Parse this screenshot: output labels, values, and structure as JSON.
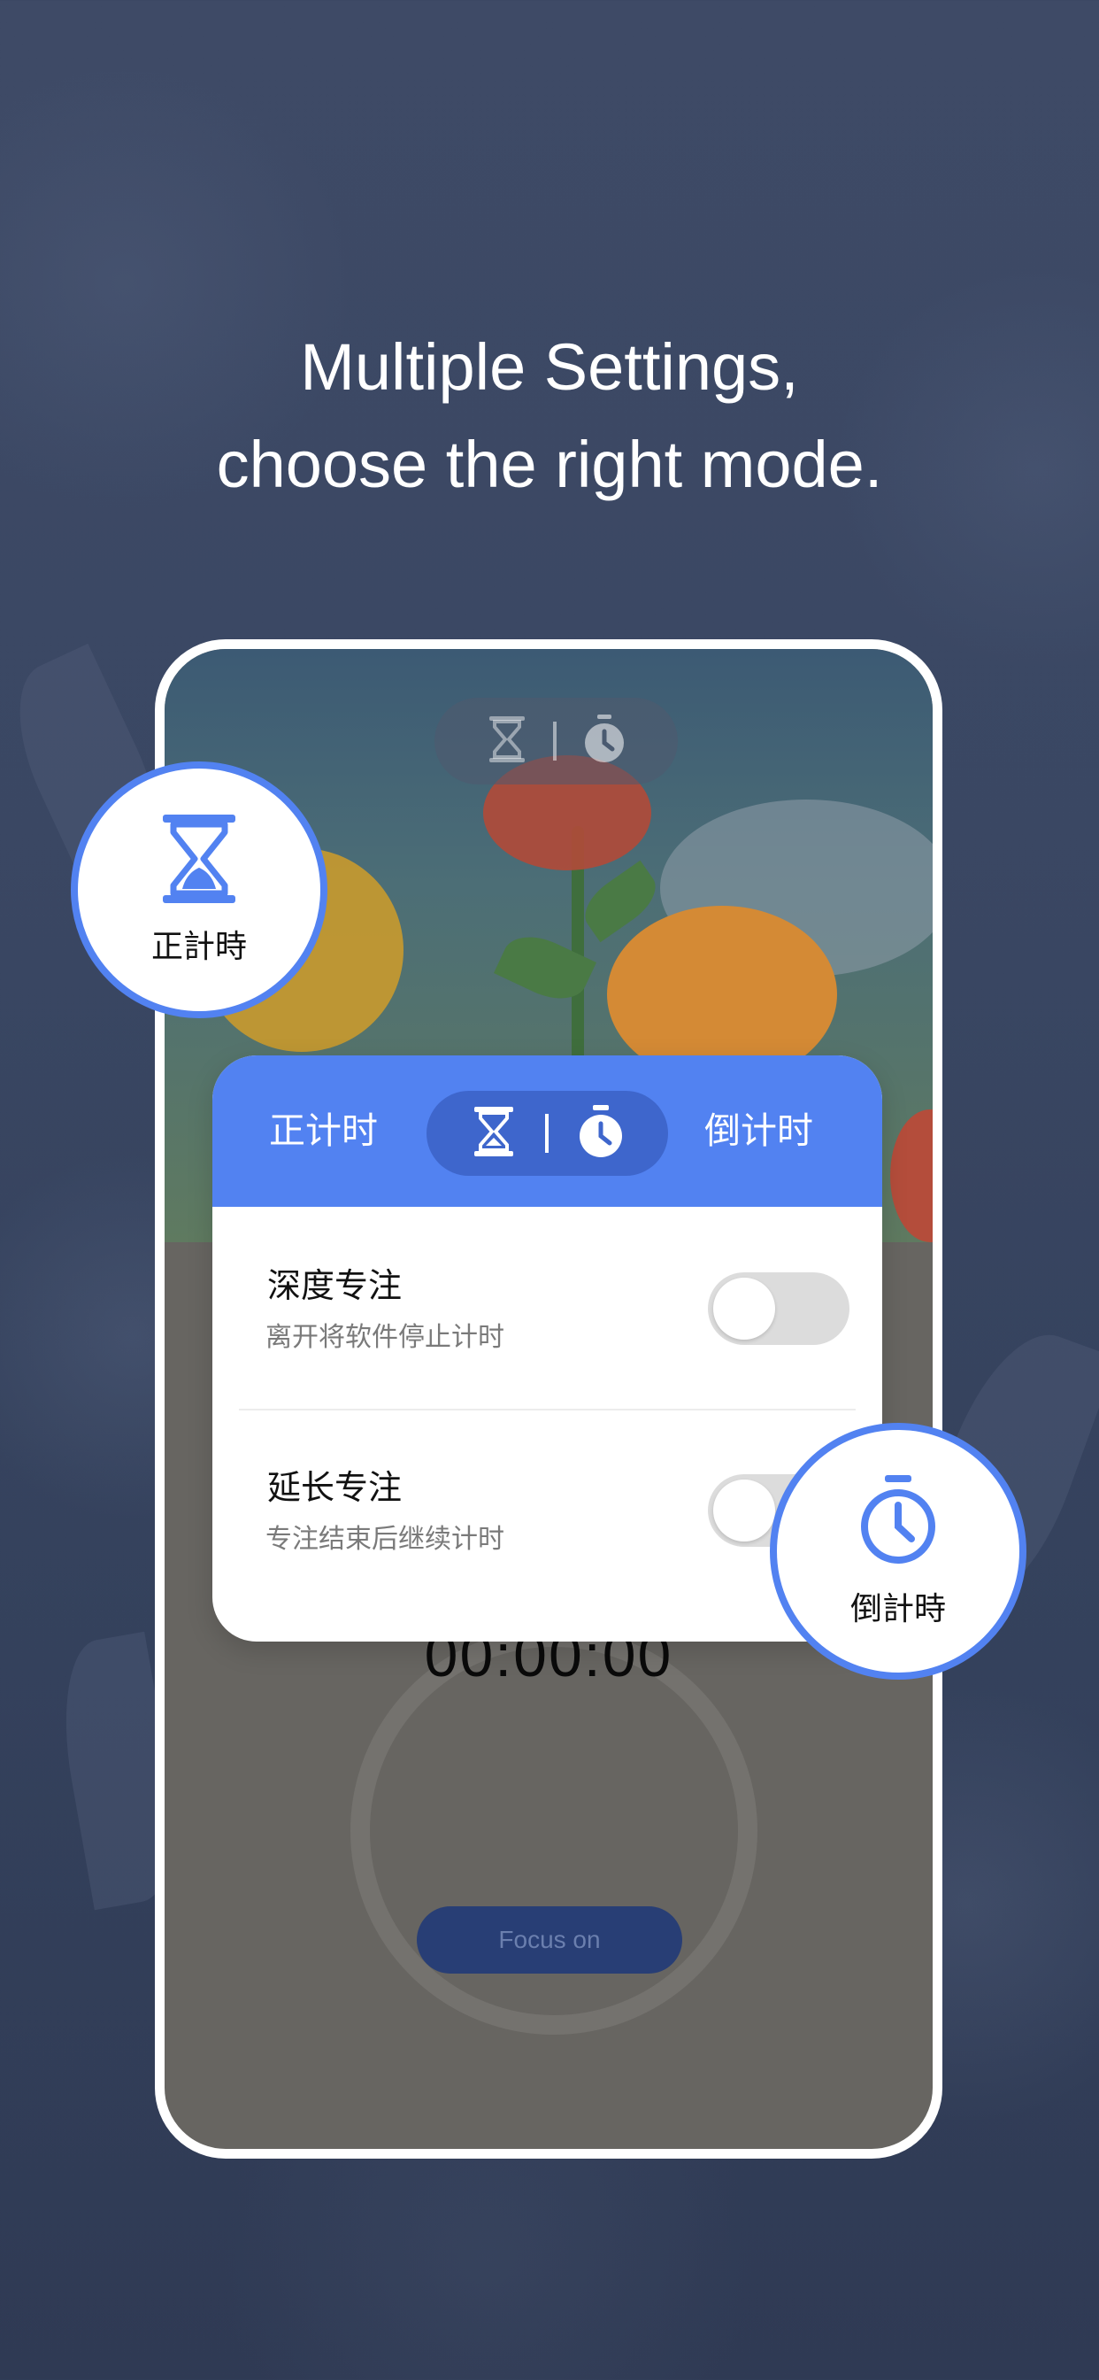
{
  "headline": {
    "line1": "Multiple Settings,",
    "line2": "choose the right mode."
  },
  "phone": {
    "timer": "00:00:00",
    "focus_button": "Focus on"
  },
  "settings_card": {
    "tab_count_up": "正计时",
    "tab_count_down": "倒计时",
    "rows": [
      {
        "title": "深度专注",
        "subtitle": "离开将软件停止计时",
        "enabled": false
      },
      {
        "title": "延长专注",
        "subtitle": "专注结束后继续计时",
        "enabled": false
      }
    ]
  },
  "badges": {
    "count_up_label": "正計時",
    "count_down_label": "倒計時"
  },
  "icons": {
    "mode_up": "hourglass-icon",
    "mode_down": "stopwatch-icon"
  },
  "colors": {
    "accent": "#5282f1",
    "accent_dark": "#3e66cc",
    "background": "#3e4a66",
    "focus_button": "#283e75"
  }
}
